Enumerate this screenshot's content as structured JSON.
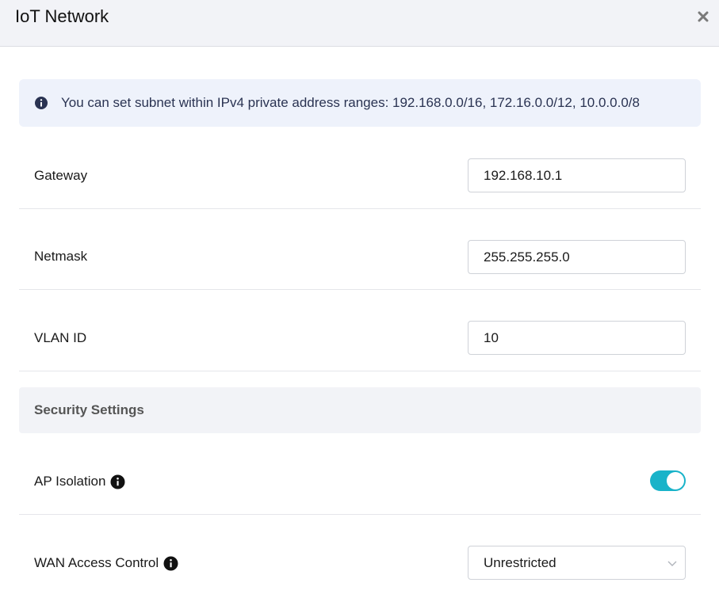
{
  "dialog": {
    "title": "IoT Network",
    "close_icon": "close-icon"
  },
  "info": {
    "icon": "info-icon",
    "text": "You can set subnet within IPv4 private address ranges: 192.168.0.0/16, 172.16.0.0/12, 10.0.0.0/8"
  },
  "fields": {
    "gateway": {
      "label": "Gateway",
      "value": "192.168.10.1"
    },
    "netmask": {
      "label": "Netmask",
      "value": "255.255.255.0"
    },
    "vlan": {
      "label": "VLAN ID",
      "value": "10"
    }
  },
  "security": {
    "title": "Security Settings",
    "ap_isolation": {
      "label": "AP Isolation",
      "help_icon": "info-icon",
      "enabled": true
    },
    "wan_access": {
      "label": "WAN Access Control",
      "help_icon": "info-icon",
      "value": "Unrestricted"
    }
  },
  "colors": {
    "toggle_on": "#19b3c9",
    "banner_bg": "#eef2fb",
    "header_bg": "#f2f3f7"
  }
}
